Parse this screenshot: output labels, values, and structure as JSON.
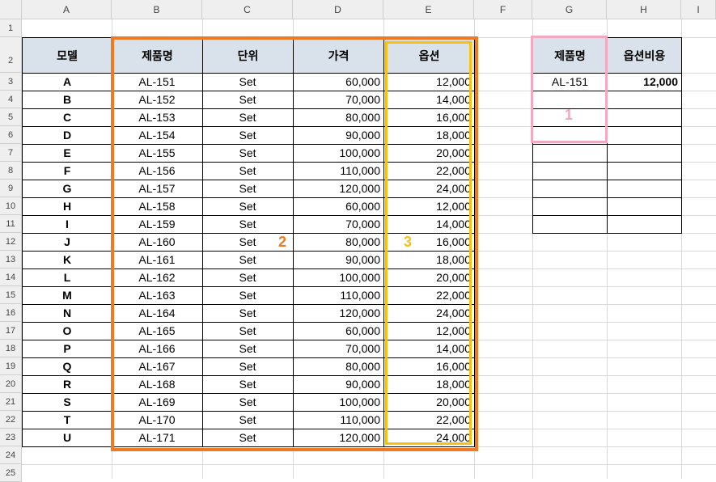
{
  "columns": [
    "A",
    "B",
    "C",
    "D",
    "E",
    "F",
    "G",
    "H",
    "I"
  ],
  "rows": [
    1,
    2,
    3,
    4,
    5,
    6,
    7,
    8,
    9,
    10,
    11,
    12,
    13,
    14,
    15,
    16,
    17,
    18,
    19,
    20,
    21,
    22,
    23,
    24,
    25
  ],
  "table_headers": [
    "모델",
    "제품명",
    "단위",
    "가격",
    "옵션"
  ],
  "table_rows": [
    [
      "A",
      "AL-151",
      "Set",
      "60,000",
      "12,000"
    ],
    [
      "B",
      "AL-152",
      "Set",
      "70,000",
      "14,000"
    ],
    [
      "C",
      "AL-153",
      "Set",
      "80,000",
      "16,000"
    ],
    [
      "D",
      "AL-154",
      "Set",
      "90,000",
      "18,000"
    ],
    [
      "E",
      "AL-155",
      "Set",
      "100,000",
      "20,000"
    ],
    [
      "F",
      "AL-156",
      "Set",
      "110,000",
      "22,000"
    ],
    [
      "G",
      "AL-157",
      "Set",
      "120,000",
      "24,000"
    ],
    [
      "H",
      "AL-158",
      "Set",
      "60,000",
      "12,000"
    ],
    [
      "I",
      "AL-159",
      "Set",
      "70,000",
      "14,000"
    ],
    [
      "J",
      "AL-160",
      "Set",
      "80,000",
      "16,000"
    ],
    [
      "K",
      "AL-161",
      "Set",
      "90,000",
      "18,000"
    ],
    [
      "L",
      "AL-162",
      "Set",
      "100,000",
      "20,000"
    ],
    [
      "M",
      "AL-163",
      "Set",
      "110,000",
      "22,000"
    ],
    [
      "N",
      "AL-164",
      "Set",
      "120,000",
      "24,000"
    ],
    [
      "O",
      "AL-165",
      "Set",
      "60,000",
      "12,000"
    ],
    [
      "P",
      "AL-166",
      "Set",
      "70,000",
      "14,000"
    ],
    [
      "Q",
      "AL-167",
      "Set",
      "80,000",
      "16,000"
    ],
    [
      "R",
      "AL-168",
      "Set",
      "90,000",
      "18,000"
    ],
    [
      "S",
      "AL-169",
      "Set",
      "100,000",
      "20,000"
    ],
    [
      "T",
      "AL-170",
      "Set",
      "110,000",
      "22,000"
    ],
    [
      "U",
      "AL-171",
      "Set",
      "120,000",
      "24,000"
    ]
  ],
  "lookup": {
    "headers": [
      "제품명",
      "옵션비용"
    ],
    "product": "AL-151",
    "option_cost": "12,000",
    "empty_rows": 8
  },
  "annotations": {
    "label_1": "1",
    "label_2": "2",
    "label_3": "3",
    "color_1": "#f4a7c0",
    "color_2": "#f07a22",
    "color_3": "#f5c211"
  },
  "colors": {
    "header_fill": "#d9e1ea",
    "header_bg": "#efefef",
    "gridline": "#d9d9d9"
  }
}
